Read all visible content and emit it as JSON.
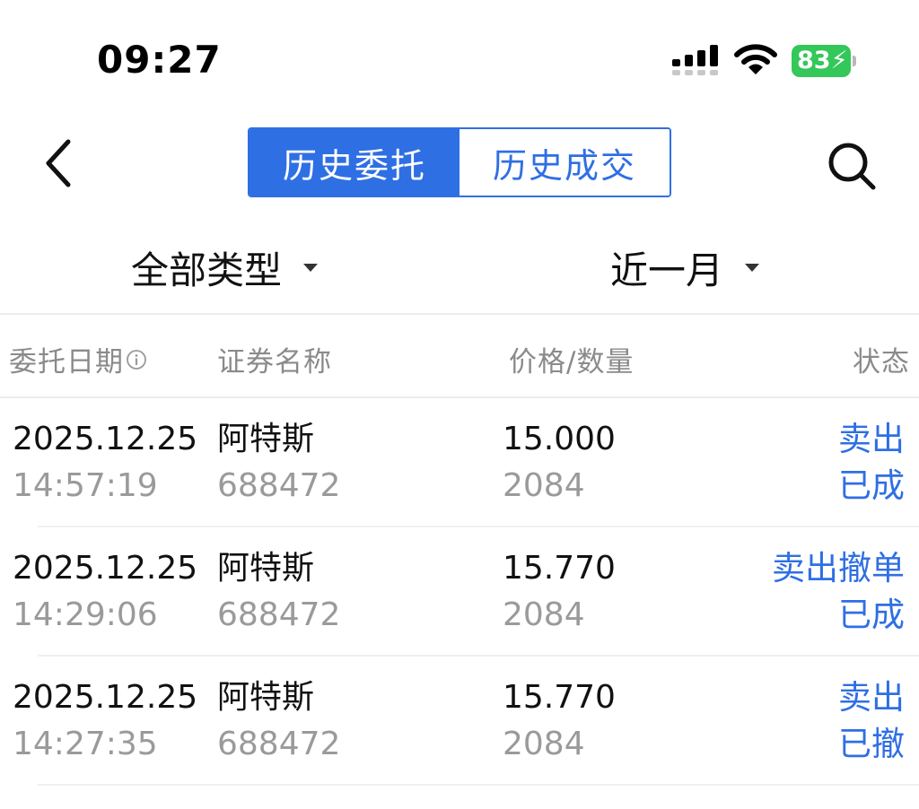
{
  "status_bar": {
    "time": "09:27",
    "battery": "83",
    "battery_color": "#34c759"
  },
  "nav": {
    "tabs": [
      {
        "label": "历史委托",
        "active": true
      },
      {
        "label": "历史成交",
        "active": false
      }
    ],
    "accent": "#2f6fe4",
    "icons": {
      "back": "chevron-left-icon",
      "search": "search-icon"
    }
  },
  "filters": {
    "type": "全部类型",
    "range": "近一月"
  },
  "table": {
    "headers": {
      "date": "委托日期",
      "name": "证券名称",
      "price_qty": "价格/数量",
      "status": "状态"
    },
    "rows": [
      {
        "date": "2025.12.25",
        "time": "14:57:19",
        "name": "阿特斯",
        "code": "688472",
        "price": "15.000",
        "qty": "2084",
        "action": "卖出",
        "status": "已成"
      },
      {
        "date": "2025.12.25",
        "time": "14:29:06",
        "name": "阿特斯",
        "code": "688472",
        "price": "15.770",
        "qty": "2084",
        "action": "卖出撤单",
        "status": "已成"
      },
      {
        "date": "2025.12.25",
        "time": "14:27:35",
        "name": "阿特斯",
        "code": "688472",
        "price": "15.770",
        "qty": "2084",
        "action": "卖出",
        "status": "已撤"
      }
    ]
  }
}
